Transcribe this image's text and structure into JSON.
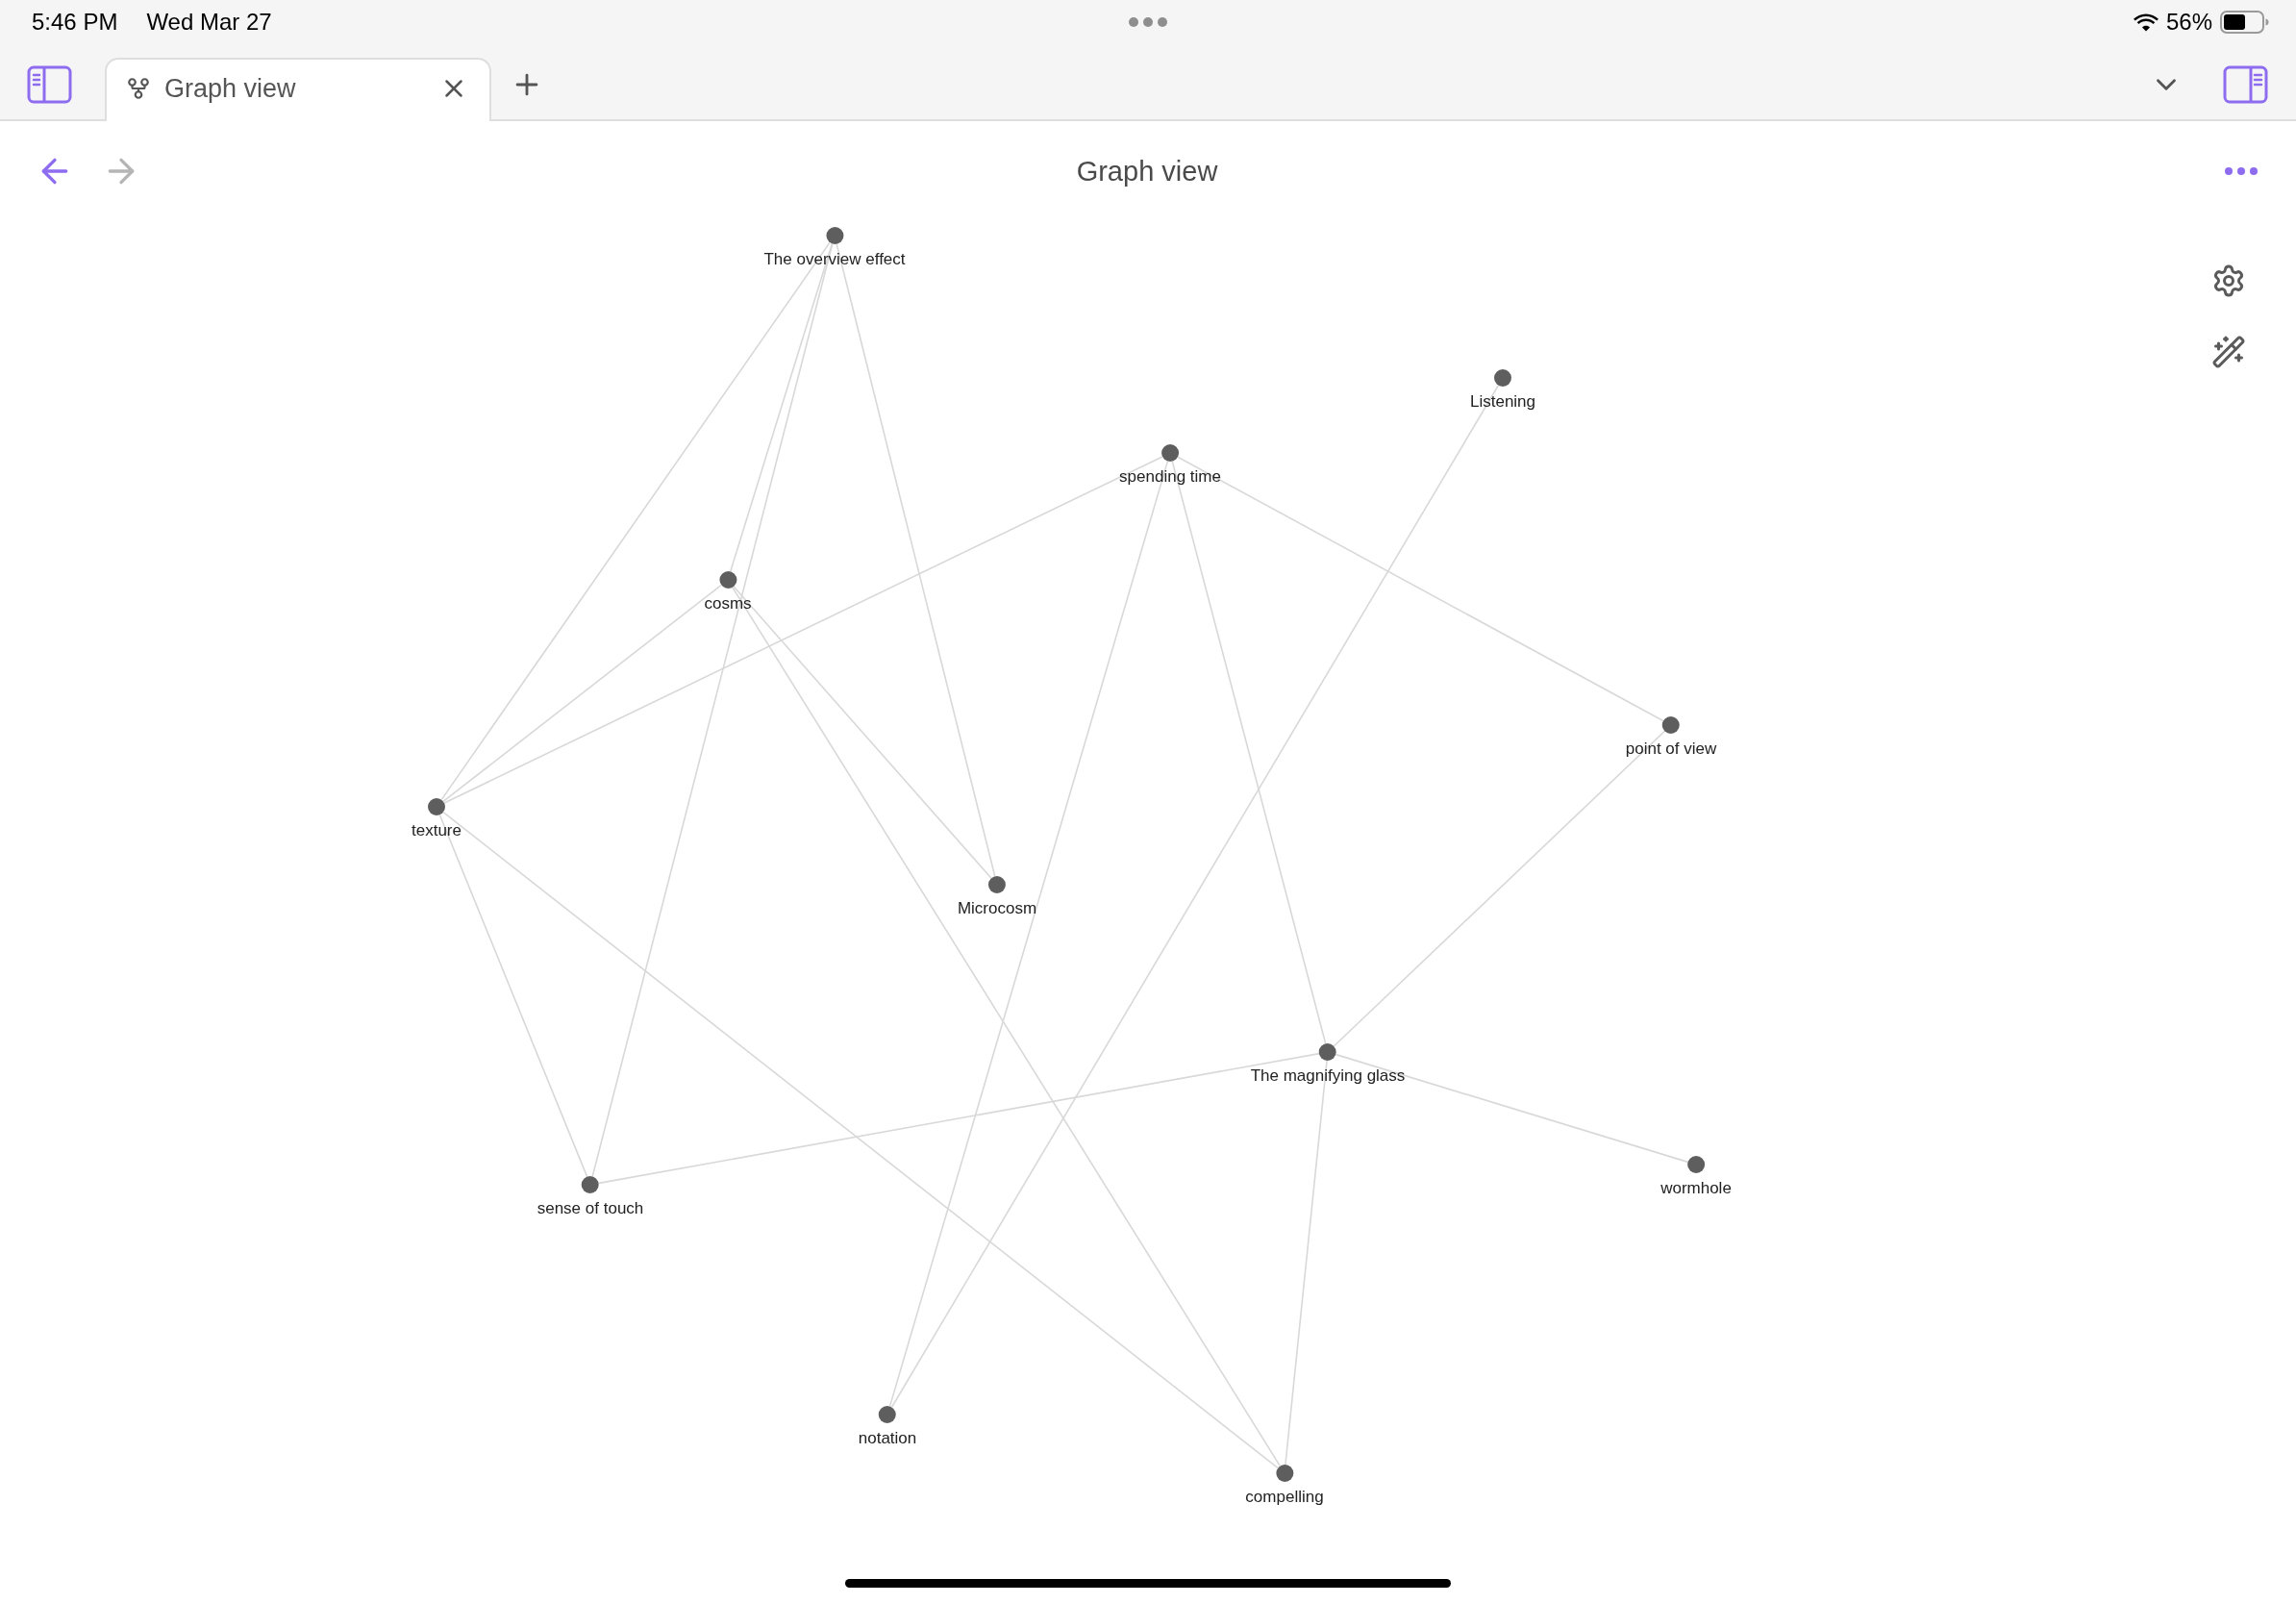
{
  "status_bar": {
    "time": "5:46 PM",
    "date": "Wed Mar 27",
    "battery": "56%"
  },
  "tabs": [
    {
      "label": "Graph view",
      "selected": true
    }
  ],
  "navigation": {
    "back": {
      "disabled": false
    },
    "forward": {
      "disabled": true
    }
  },
  "header": {
    "title": "Graph view"
  },
  "graph": {
    "nodes": [
      {
        "label": "The overview effect"
      },
      {
        "label": "Listening"
      },
      {
        "label": "spending time"
      },
      {
        "label": "cosms"
      },
      {
        "label": "point of view"
      },
      {
        "label": "texture"
      },
      {
        "label": "Microcosm"
      },
      {
        "label": "The magnifying glass"
      },
      {
        "label": "wormhole"
      },
      {
        "label": "sense of touch"
      },
      {
        "label": "notation"
      },
      {
        "label": "compelling"
      }
    ]
  }
}
